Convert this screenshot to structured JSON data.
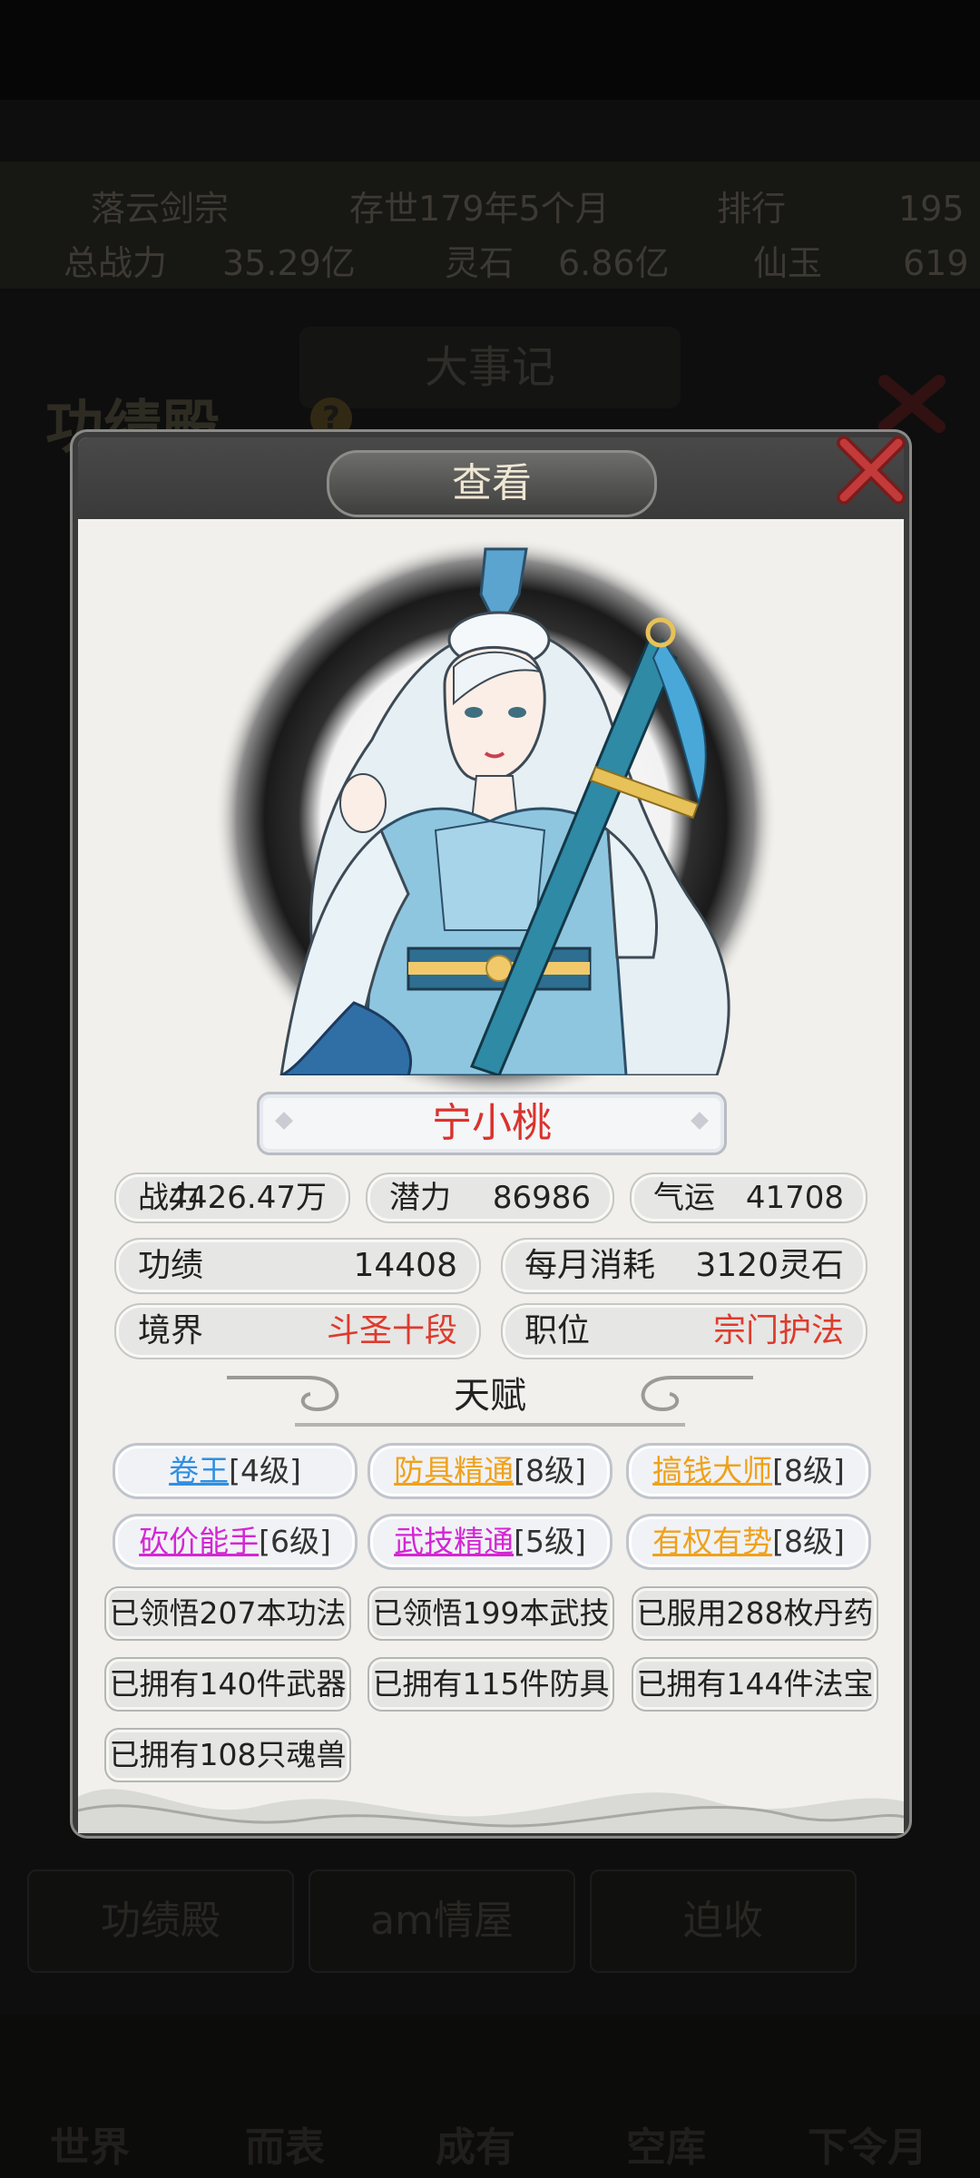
{
  "background": {
    "stats_row1": [
      "落云剑宗",
      "存世179年5个月",
      "排行",
      "195"
    ],
    "stats_row2": [
      "总战力",
      "35.29亿",
      "灵石",
      "6.86亿",
      "仙玉",
      "619"
    ],
    "hall_title": "功绩殿",
    "help_mark": "?",
    "dashes_label": "大事记",
    "bottom_tabs": [
      "功绩殿",
      "am情屋",
      "迫收"
    ],
    "nav": [
      "世界",
      "而表",
      "成有",
      "空库",
      "下令月"
    ]
  },
  "modal": {
    "title": "查看",
    "character": {
      "name": "宁小桃",
      "portrait_icon": "cultivator-heroine-portrait"
    },
    "row1": [
      {
        "label": "战力",
        "value": "4426.47万"
      },
      {
        "label": "潜力",
        "value": "86986"
      },
      {
        "label": "气运",
        "value": "41708"
      }
    ],
    "row2": [
      {
        "label": "功绩",
        "value": "14408"
      },
      {
        "label": "每月消耗",
        "value": "3120灵石"
      }
    ],
    "row3": [
      {
        "label": "境界",
        "value": "斗圣十段"
      },
      {
        "label": "职位",
        "value": "宗门护法"
      }
    ],
    "talent_section_title": "天赋",
    "talents": [
      {
        "name": "卷王",
        "level": "[4级]",
        "color": "#2f8fe0"
      },
      {
        "name": "防具精通",
        "level": "[8级]",
        "color": "#f0a11a"
      },
      {
        "name": "搞钱大师",
        "level": "[8级]",
        "color": "#f0a11a"
      },
      {
        "name": "砍价能手",
        "level": "[6级]",
        "color": "#d426d4"
      },
      {
        "name": "武技精通",
        "level": "[5级]",
        "color": "#d426d4"
      },
      {
        "name": "有权有势",
        "level": "[8级]",
        "color": "#f0a11a"
      }
    ],
    "achievements": [
      "已领悟207本功法",
      "已领悟199本武技",
      "已服用288枚丹药",
      "已拥有140件武器",
      "已拥有115件防具",
      "已拥有144件法宝",
      "已拥有108只魂兽"
    ],
    "close_icon": "close-x-icon"
  }
}
